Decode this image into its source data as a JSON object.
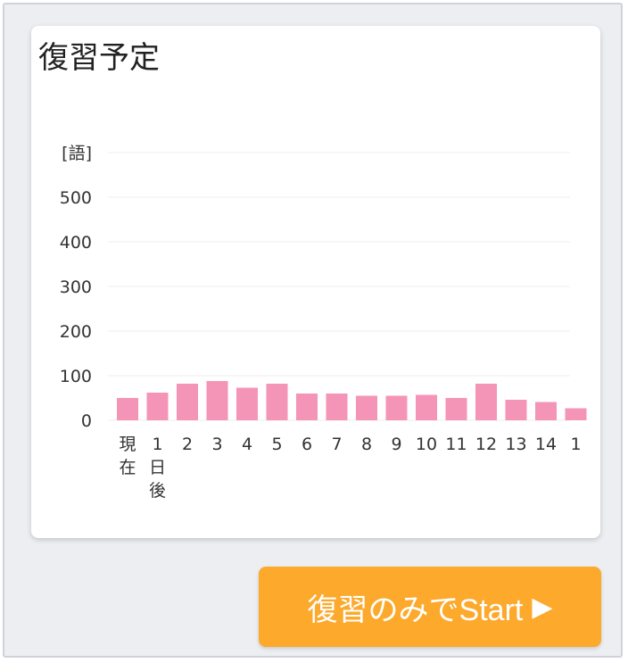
{
  "card": {
    "title": "復習予定"
  },
  "chart_data": {
    "type": "bar",
    "unit_label": "[語]",
    "y_ticks": [
      "0",
      "100",
      "200",
      "300",
      "400",
      "500"
    ],
    "ylim": [
      0,
      600
    ],
    "categories": [
      [
        "現",
        "在"
      ],
      [
        "1",
        "日",
        "後"
      ],
      [
        "2"
      ],
      [
        "3"
      ],
      [
        "4"
      ],
      [
        "5"
      ],
      [
        "6"
      ],
      [
        "7"
      ],
      [
        "8"
      ],
      [
        "9"
      ],
      [
        "10"
      ],
      [
        "11"
      ],
      [
        "12"
      ],
      [
        "13"
      ],
      [
        "14"
      ],
      [
        "1"
      ]
    ],
    "values": [
      50,
      62,
      82,
      88,
      73,
      82,
      60,
      60,
      55,
      55,
      57,
      50,
      82,
      46,
      41,
      27
    ],
    "bar_color": "#f494b7",
    "grid": true
  },
  "actions": {
    "start_review_label": "復習のみでStart",
    "start_icon": "play-triangle-icon"
  }
}
